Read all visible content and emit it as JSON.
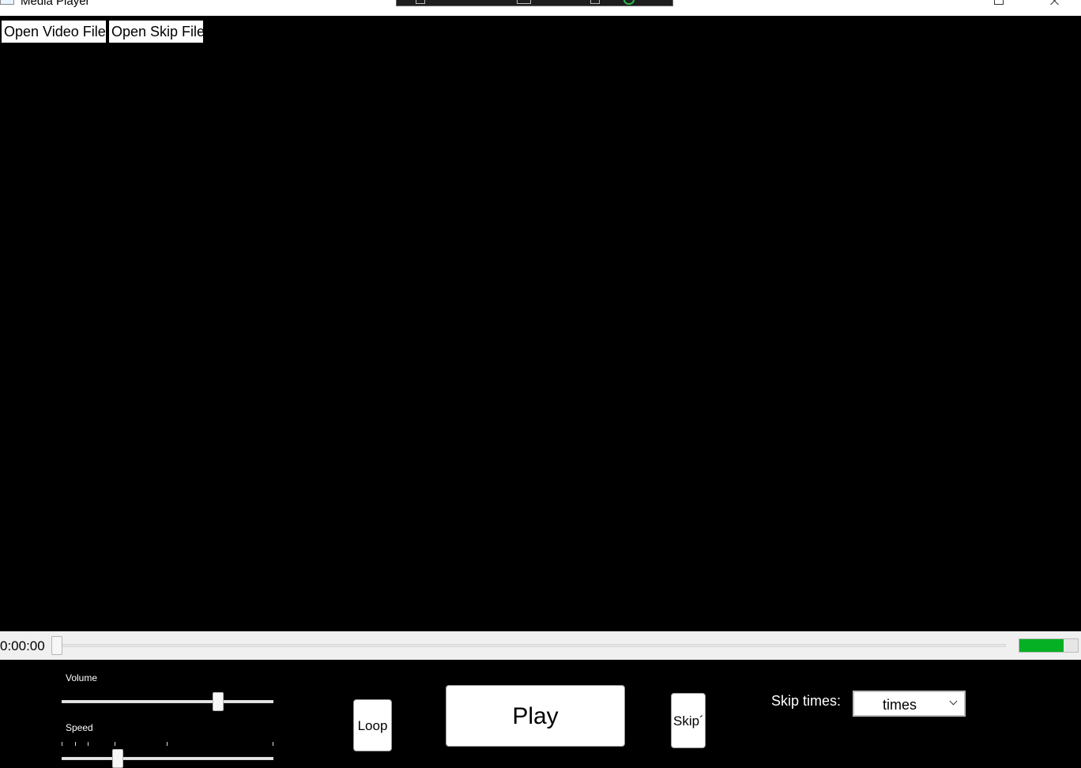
{
  "window": {
    "title": "Media Player"
  },
  "top_buttons": {
    "open_video": "Open Video File",
    "open_skip": "Open Skip File"
  },
  "seek": {
    "time": "0:00:00",
    "position_fraction": 0.0
  },
  "progress": {
    "fraction": 0.75,
    "color": "#06b025"
  },
  "volume": {
    "label": "Volume",
    "fraction": 0.75
  },
  "speed": {
    "label": "Speed",
    "fraction": 0.25
  },
  "buttons": {
    "loop": "Loop",
    "play": "Play",
    "skip": "Skip´"
  },
  "skip_times": {
    "label": "Skip times:",
    "selected": "times"
  }
}
